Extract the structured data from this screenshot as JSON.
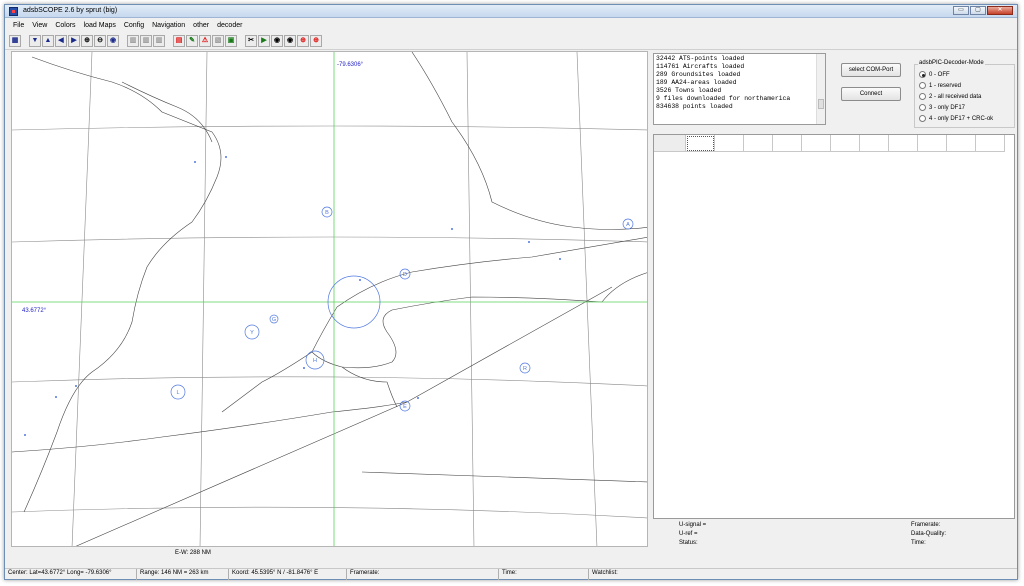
{
  "window": {
    "title": "adsbSCOPE 2.6 by sprut  (big)",
    "minimize_glyph": "▭",
    "maximize_glyph": "▢",
    "close_glyph": "✕"
  },
  "menu": [
    "File",
    "View",
    "Colors",
    "load Maps",
    "Config",
    "Navigation",
    "other",
    "decoder"
  ],
  "toolbar_icons": [
    {
      "name": "table-icon",
      "glyph": "▦"
    },
    {
      "name": "arrow-down-icon",
      "glyph": "▼"
    },
    {
      "name": "arrow-up-icon",
      "glyph": "▲"
    },
    {
      "name": "arrow-left-icon",
      "glyph": "◀"
    },
    {
      "name": "arrow-right-icon",
      "glyph": "▶"
    },
    {
      "name": "zoom-in-icon",
      "glyph": "⊕"
    },
    {
      "name": "zoom-out-icon",
      "glyph": "⊖"
    },
    {
      "name": "globe-icon",
      "glyph": "◉"
    },
    {
      "name": "building-1-icon",
      "glyph": "▥"
    },
    {
      "name": "building-2-icon",
      "glyph": "▥"
    },
    {
      "name": "building-3-icon",
      "glyph": "▥"
    },
    {
      "name": "chart-icon",
      "glyph": "▤"
    },
    {
      "name": "pencil-icon",
      "glyph": "✎"
    },
    {
      "name": "warning-icon",
      "glyph": "⚠"
    },
    {
      "name": "note-icon",
      "glyph": "▧"
    },
    {
      "name": "monitor-icon",
      "glyph": "▣"
    },
    {
      "name": "tools-icon",
      "glyph": "✂"
    },
    {
      "name": "play-icon",
      "glyph": "▶"
    },
    {
      "name": "target-dot-icon",
      "glyph": "◉"
    },
    {
      "name": "target-dot-2-icon",
      "glyph": "◉"
    },
    {
      "name": "crosshair-icon",
      "glyph": "⊕"
    },
    {
      "name": "crosshair-2-icon",
      "glyph": "⊕"
    }
  ],
  "map": {
    "longitude_label": "-79.6306°",
    "latitude_label": "43.6772°",
    "markers": [
      "B",
      "D",
      "H",
      "L",
      "R",
      "E",
      "A",
      "Y",
      "G"
    ],
    "grid_color": "#7f7f7f",
    "crosshair_color": "#50d050",
    "marker_color": "#5078e0"
  },
  "ew_label": "E-W: 288 NM",
  "log": {
    "lines": [
      "32442 ATS-points loaded",
      "114761 Aircrafts loaded",
      "289 Groundsites loaded",
      "189 AA24-areas loaded",
      "3526 Towns loaded",
      "9 files downloaded for northamerica",
      "834638 points loaded"
    ]
  },
  "buttons": {
    "select_com_port": "select COM-Port",
    "connect": "Connect"
  },
  "decoder_mode": {
    "title": "adsbPIC-Decoder-Mode",
    "options": [
      "0 - OFF",
      "1 - reserved",
      "2 - all received data",
      "3 - only DF17",
      "4 - only DF17 + CRC-ok"
    ],
    "selected_index": 0
  },
  "info": {
    "u_signal": "U-signal =",
    "u_ref": "U-ref =",
    "status": "Status:",
    "framerate": "Framerate:",
    "data_quality": "Data-Quality:",
    "time": "Time:"
  },
  "statusbar": {
    "center": "Center: Lat=43.6772° Long= -79.6306°",
    "range": "Range: 146 NM = 263 km",
    "koord": "Koord: 45.5395° N / -81.8476° E",
    "framerate": "Framerate:",
    "time": "Time:",
    "watchlist": "Watchlist:"
  }
}
